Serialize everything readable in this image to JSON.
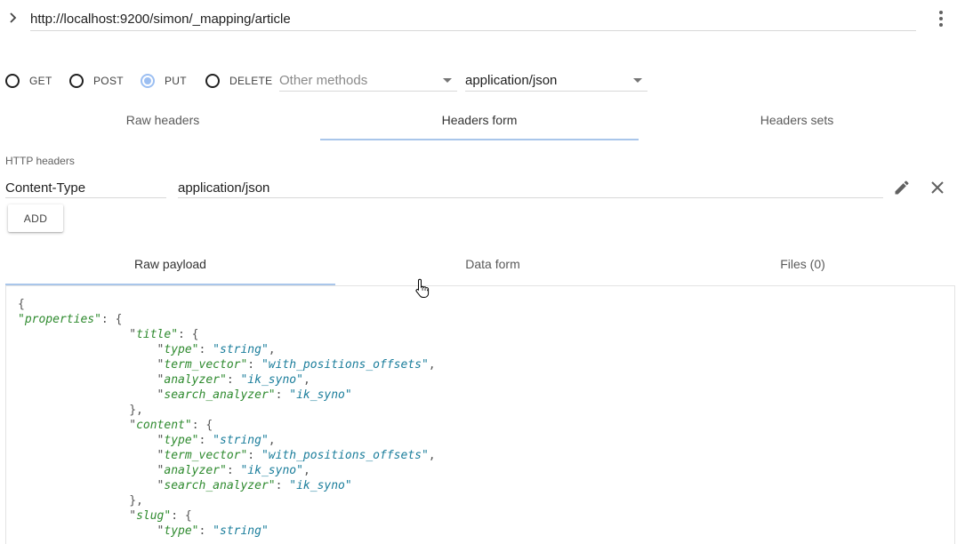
{
  "request": {
    "url": "http://localhost:9200/simon/_mapping/article",
    "url_toggle_icon": "chevron-right-icon",
    "menu_icon": "more-vert-icon"
  },
  "methods": [
    {
      "label": "GET",
      "checked": false
    },
    {
      "label": "POST",
      "checked": false
    },
    {
      "label": "PUT",
      "checked": true
    },
    {
      "label": "DELETE",
      "checked": false
    }
  ],
  "other_methods": {
    "placeholder": "Other methods"
  },
  "content_type_select": {
    "value": "application/json"
  },
  "header_tabs": [
    {
      "label": "Raw headers",
      "active": false
    },
    {
      "label": "Headers form",
      "active": true
    },
    {
      "label": "Headers sets",
      "active": false
    }
  ],
  "headers_form": {
    "section_label": "HTTP headers",
    "rows": [
      {
        "name": "Content-Type",
        "value": "application/json"
      }
    ],
    "add_label": "ADD",
    "edit_icon": "pencil-icon",
    "remove_icon": "close-icon"
  },
  "payload_tabs": [
    {
      "label": "Raw payload",
      "active": true
    },
    {
      "label": "Data form",
      "active": false
    },
    {
      "label": "Files (0)",
      "active": false
    }
  ],
  "payload_lines": [
    [
      {
        "t": "p",
        "v": "{"
      }
    ],
    [
      {
        "t": "k",
        "v": "\"properties\""
      },
      {
        "t": "p",
        "v": ": {"
      }
    ],
    [
      {
        "t": "p",
        "v": "                \""
      },
      {
        "t": "k",
        "v": "title\""
      },
      {
        "t": "p",
        "v": ": {"
      }
    ],
    [
      {
        "t": "p",
        "v": "                    \""
      },
      {
        "t": "k",
        "v": "type\""
      },
      {
        "t": "p",
        "v": ": "
      },
      {
        "t": "s",
        "v": "\"string\""
      },
      {
        "t": "p",
        "v": ","
      }
    ],
    [
      {
        "t": "p",
        "v": "                    \""
      },
      {
        "t": "k",
        "v": "term_vector\""
      },
      {
        "t": "p",
        "v": ": "
      },
      {
        "t": "s",
        "v": "\"with_positions_offsets\""
      },
      {
        "t": "p",
        "v": ","
      }
    ],
    [
      {
        "t": "p",
        "v": "                    \""
      },
      {
        "t": "k",
        "v": "analyzer\""
      },
      {
        "t": "p",
        "v": ": "
      },
      {
        "t": "s",
        "v": "\"ik_syno\""
      },
      {
        "t": "p",
        "v": ","
      }
    ],
    [
      {
        "t": "p",
        "v": "                    \""
      },
      {
        "t": "k",
        "v": "search_analyzer\""
      },
      {
        "t": "p",
        "v": ": "
      },
      {
        "t": "s",
        "v": "\"ik_syno\""
      }
    ],
    [
      {
        "t": "p",
        "v": "                },"
      }
    ],
    [
      {
        "t": "p",
        "v": "                \""
      },
      {
        "t": "k",
        "v": "content\""
      },
      {
        "t": "p",
        "v": ": {"
      }
    ],
    [
      {
        "t": "p",
        "v": "                    \""
      },
      {
        "t": "k",
        "v": "type\""
      },
      {
        "t": "p",
        "v": ": "
      },
      {
        "t": "s",
        "v": "\"string\""
      },
      {
        "t": "p",
        "v": ","
      }
    ],
    [
      {
        "t": "p",
        "v": "                    \""
      },
      {
        "t": "k",
        "v": "term_vector\""
      },
      {
        "t": "p",
        "v": ": "
      },
      {
        "t": "s",
        "v": "\"with_positions_offsets\""
      },
      {
        "t": "p",
        "v": ","
      }
    ],
    [
      {
        "t": "p",
        "v": "                    \""
      },
      {
        "t": "k",
        "v": "analyzer\""
      },
      {
        "t": "p",
        "v": ": "
      },
      {
        "t": "s",
        "v": "\"ik_syno\""
      },
      {
        "t": "p",
        "v": ","
      }
    ],
    [
      {
        "t": "p",
        "v": "                    \""
      },
      {
        "t": "k",
        "v": "search_analyzer\""
      },
      {
        "t": "p",
        "v": ": "
      },
      {
        "t": "s",
        "v": "\"ik_syno\""
      }
    ],
    [
      {
        "t": "p",
        "v": "                },"
      }
    ],
    [
      {
        "t": "p",
        "v": "                \""
      },
      {
        "t": "k",
        "v": "slug\""
      },
      {
        "t": "p",
        "v": ": {"
      }
    ],
    [
      {
        "t": "p",
        "v": "                    \""
      },
      {
        "t": "k",
        "v": "type\""
      },
      {
        "t": "p",
        "v": ": "
      },
      {
        "t": "s",
        "v": "\"string\""
      }
    ]
  ],
  "colors": {
    "accent": "#a9c6ea",
    "radio_checked": "#9cbff2",
    "json_key": "#2e8a2e",
    "json_string": "#1a7d9b"
  }
}
